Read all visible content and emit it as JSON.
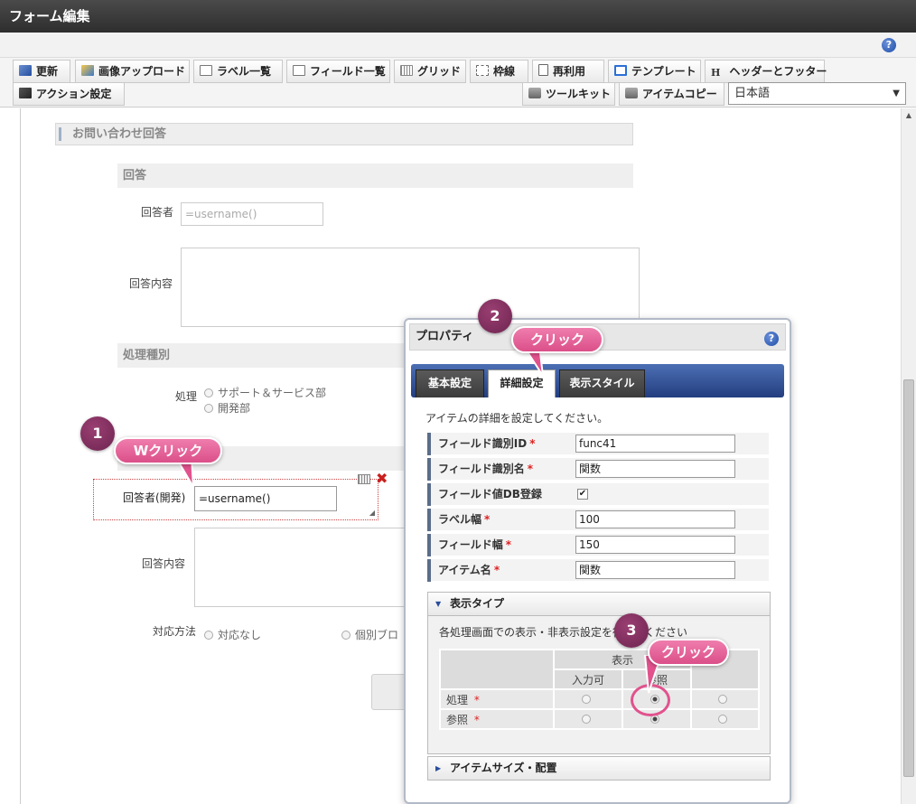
{
  "window": {
    "title": "フォーム編集"
  },
  "toolbar": {
    "row1": [
      {
        "label": "更新",
        "icon": "refresh-icon"
      },
      {
        "label": "画像アップロード",
        "icon": "image-upload-icon"
      },
      {
        "label": "ラベル一覧",
        "icon": "list-icon"
      },
      {
        "label": "フィールド一覧",
        "icon": "list-icon"
      },
      {
        "label": "グリッド",
        "icon": "grid-icon"
      },
      {
        "label": "枠線",
        "icon": "border-icon"
      },
      {
        "label": "再利用",
        "icon": "document-icon"
      },
      {
        "label": "テンプレート",
        "icon": "template-icon"
      },
      {
        "label": "ヘッダーとフッター",
        "icon": "header-icon"
      }
    ],
    "row2": [
      {
        "label": "アクション設定",
        "icon": "action-icon"
      },
      {
        "label": "ツールキット",
        "icon": "toolkit-icon"
      },
      {
        "label": "アイテムコピー",
        "icon": "toolkit-icon"
      }
    ],
    "language": "日本語"
  },
  "form": {
    "section_title": "お問い合わせ回答",
    "answer_head": "回答",
    "answerer_label": "回答者",
    "answerer_value": "=username()",
    "answer_content_label": "回答内容",
    "process_type_head": "処理種別",
    "process_label": "処理",
    "process_options": [
      "サポート＆サービス部",
      "開発部"
    ],
    "dev_answerer_label": "回答者(開発)",
    "dev_answerer_value": "=username()",
    "dev_content_label": "回答内容",
    "method_label": "対応方法",
    "method_option_1": "対応なし",
    "method_option_2": "個別ブロ"
  },
  "properties": {
    "title": "プロパティ",
    "tabs": [
      "基本設定",
      "詳細設定",
      "表示スタイル"
    ],
    "active_tab": "詳細設定",
    "description": "アイテムの詳細を設定してください。",
    "rows": [
      {
        "label": "フィールド識別ID",
        "required": true,
        "value": "func41"
      },
      {
        "label": "フィールド識別名",
        "required": true,
        "value": "関数"
      },
      {
        "label": "フィールド値DB登録",
        "required": false,
        "value": "✔"
      },
      {
        "label": "ラベル幅",
        "required": true,
        "value": "100"
      },
      {
        "label": "フィールド幅",
        "required": true,
        "value": "150"
      },
      {
        "label": "アイテム名",
        "required": true,
        "value": "関数"
      }
    ],
    "required_mark": "*",
    "display_type": {
      "title": "表示タイプ",
      "description": "各処理画面での表示・非表示設定を行ってください",
      "header_display": "表示",
      "header_input": "入力可",
      "header_ref": "参照",
      "rows": [
        {
          "label": "処理",
          "selected": "参照"
        },
        {
          "label": "参照",
          "selected": "参照"
        }
      ]
    },
    "size_section": "アイテムサイズ・配置"
  },
  "annotations": {
    "step1": "1",
    "step1_label": "Wクリック",
    "step2": "2",
    "step2_label": "クリック",
    "step3": "3",
    "step3_label": "クリック",
    "highlight_color": "#e1528d"
  }
}
